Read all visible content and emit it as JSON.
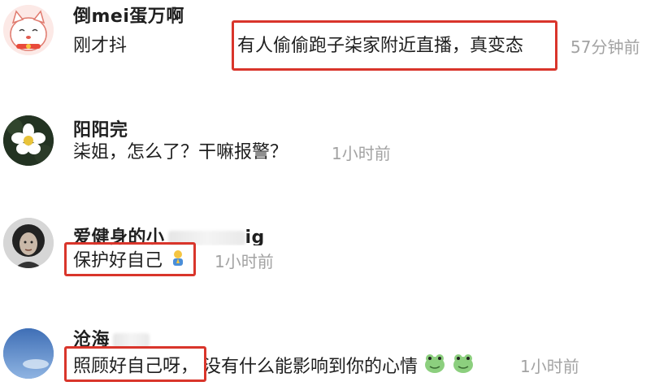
{
  "comments": [
    {
      "username": "倒mei蛋万啊",
      "prefix": "刚才抖",
      "text": "有人偷偷跑子柒家附近直播，真变态",
      "time": "57分钟前"
    },
    {
      "username": "阳阳完",
      "text": "柒姐，怎么了？干嘛报警？",
      "time": "1小时前"
    },
    {
      "username": "爱健身的小",
      "username_tail": "ig",
      "text": "保护好自己",
      "time": "1小时前"
    },
    {
      "username": "沧海",
      "text_highlight": "照顾好自己呀，",
      "text_rest": "没有什么能影响到你的心情",
      "time": "1小时前"
    }
  ],
  "colors": {
    "highlight": "#d9352b",
    "time": "#a3a3a3",
    "text": "#1f1f1f"
  }
}
